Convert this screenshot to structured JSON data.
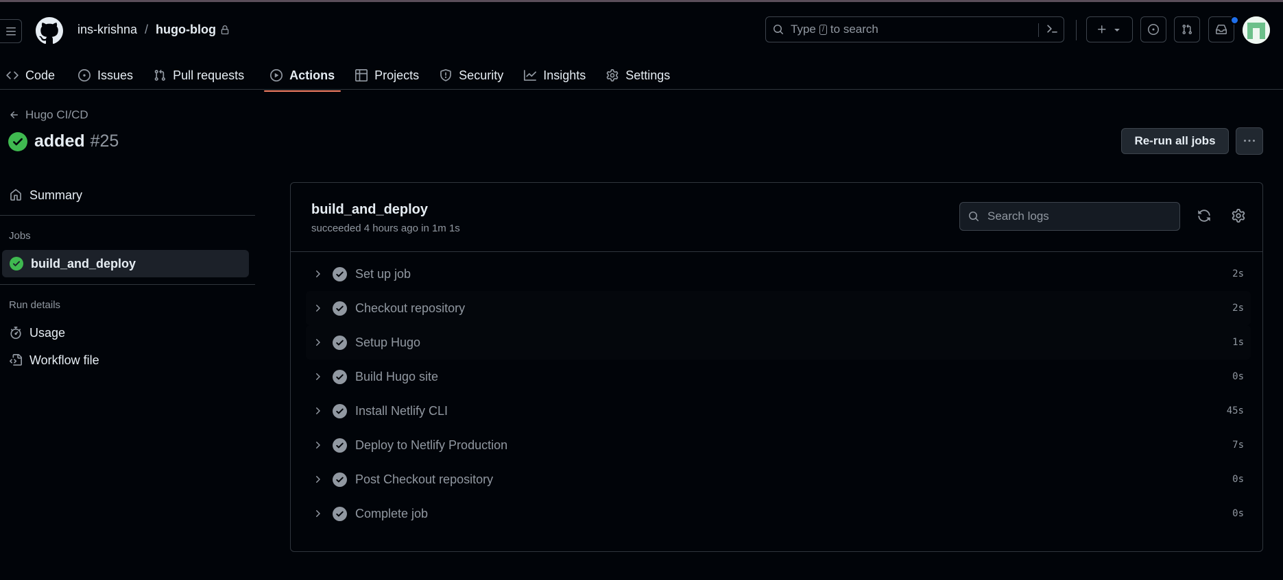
{
  "header": {
    "owner": "ins-krishna",
    "separator": "/",
    "repo": "hugo-blog",
    "search": {
      "prefix": "Type",
      "key": "/",
      "suffix": "to search"
    }
  },
  "tabs": [
    {
      "label": "Code",
      "icon": "code-icon"
    },
    {
      "label": "Issues",
      "icon": "issue-opened-icon"
    },
    {
      "label": "Pull requests",
      "icon": "git-pull-request-icon"
    },
    {
      "label": "Actions",
      "icon": "play-icon",
      "active": true
    },
    {
      "label": "Projects",
      "icon": "table-icon"
    },
    {
      "label": "Security",
      "icon": "shield-icon"
    },
    {
      "label": "Insights",
      "icon": "graph-icon"
    },
    {
      "label": "Settings",
      "icon": "gear-icon"
    }
  ],
  "run": {
    "workflow": "Hugo CI/CD",
    "title": "added",
    "number": "#25",
    "rerun_label": "Re-run all jobs"
  },
  "sidebar": {
    "summary": "Summary",
    "jobs_heading": "Jobs",
    "job": "build_and_deploy",
    "run_details_heading": "Run details",
    "usage": "Usage",
    "workflow_file": "Workflow file"
  },
  "job": {
    "name": "build_and_deploy",
    "status": "succeeded 4 hours ago in 1m 1s",
    "search_placeholder": "Search logs",
    "steps": [
      {
        "name": "Set up job",
        "duration": "2s"
      },
      {
        "name": "Checkout repository",
        "duration": "2s"
      },
      {
        "name": "Setup Hugo",
        "duration": "1s"
      },
      {
        "name": "Build Hugo site",
        "duration": "0s"
      },
      {
        "name": "Install Netlify CLI",
        "duration": "45s"
      },
      {
        "name": "Deploy to Netlify Production",
        "duration": "7s"
      },
      {
        "name": "Post Checkout repository",
        "duration": "0s"
      },
      {
        "name": "Complete job",
        "duration": "0s"
      }
    ]
  },
  "colors": {
    "background": "#010409",
    "success": "#3fb950",
    "active_tab_underline": "#f78166",
    "notification": "#1f6feb"
  }
}
